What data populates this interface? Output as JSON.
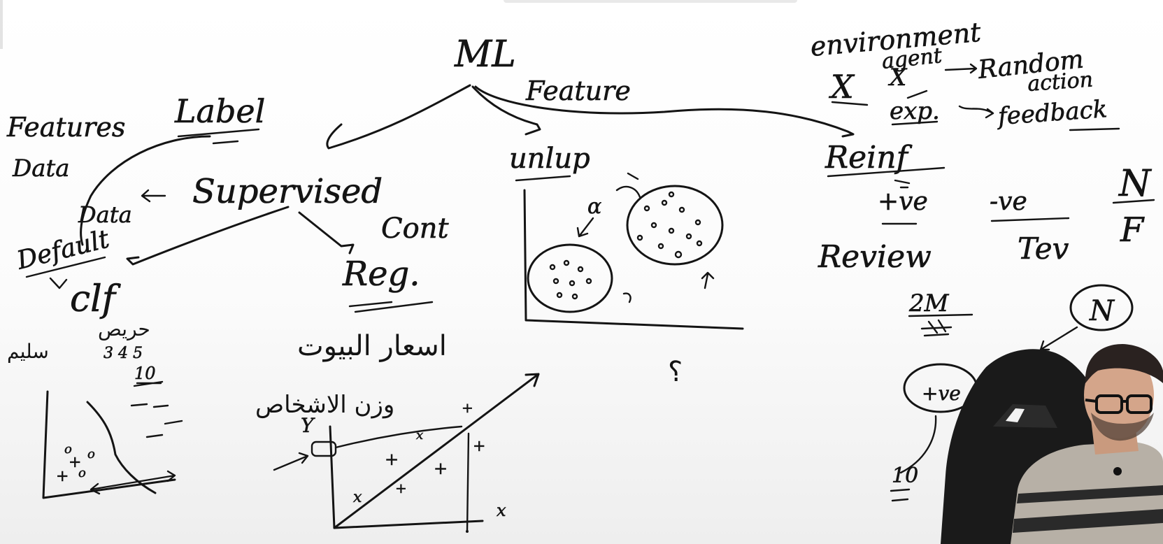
{
  "board": {
    "root": "ML",
    "root_note": "Feature",
    "left_notes": {
      "features": "Features",
      "data": "Data",
      "label": "Label"
    },
    "supervised": {
      "title": "Supervised",
      "arrow_note": "Data",
      "branch_a": "Default",
      "clf": "clf",
      "cont": "Cont",
      "reg": "Reg.",
      "clf_arabic_top": "حريص",
      "clf_arabic_left": "سليم",
      "clf_numbers": "3  4  5",
      "clf_ten": "10",
      "reg_arabic_1": "اسعار البيوت",
      "reg_arabic_2": "وزن الاشخاص",
      "reg_y": "Y",
      "reg_x": "x"
    },
    "unsupervised": {
      "title": "unlup",
      "alpha": "α",
      "qmark": "؟"
    },
    "reinforcement": {
      "environment": "environment",
      "agent": "agent",
      "x": "X",
      "random": "Random",
      "action": "action",
      "exp": "exp.",
      "feedback": "feedback",
      "title": "Reinf",
      "pos": "+ve",
      "neg": "-ve",
      "review": "Review",
      "n_letter": "N",
      "f_letter": "F",
      "tev": "Tev",
      "two_m": "2M",
      "circle_n": "N",
      "circle_pos": "+ve",
      "ten": "10"
    }
  },
  "presenter": {
    "label": "presenter-webcam"
  },
  "colors": {
    "ink": "#141414",
    "board": "#ffffff",
    "chair": "#1a1a1a",
    "shirt_stripe": "#2a2a2a"
  }
}
